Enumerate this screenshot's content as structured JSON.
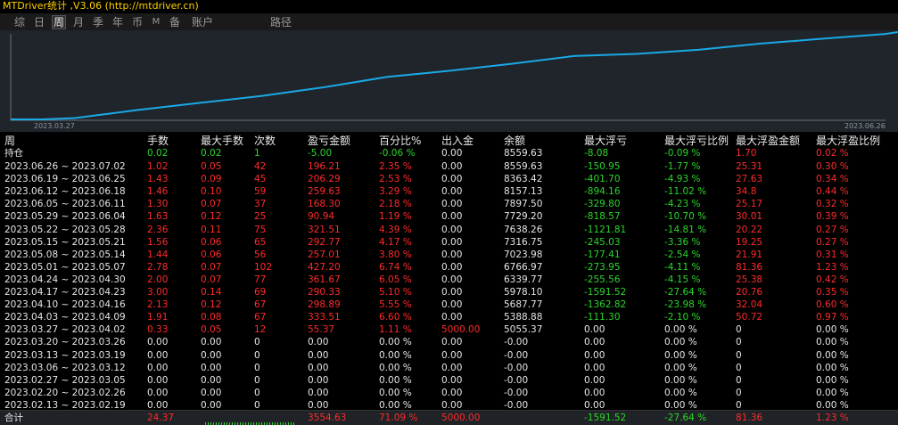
{
  "window": {
    "title": "MTDriver统计 ,V3.06 (http://mtdriver.cn)"
  },
  "tabs": [
    {
      "label": "综",
      "active": false
    },
    {
      "label": "日",
      "active": false
    },
    {
      "label": "周",
      "active": true
    },
    {
      "label": "月",
      "active": false
    },
    {
      "label": "季",
      "active": false
    },
    {
      "label": "年",
      "active": false
    },
    {
      "label": "币",
      "active": false
    },
    {
      "label": "M",
      "active": false
    },
    {
      "label": "备",
      "active": false
    },
    {
      "label": "账户",
      "active": false
    },
    {
      "label": "路径",
      "active": false
    }
  ],
  "colors": {
    "curve": "#1aa9e6",
    "red": "#ff2a2a",
    "green": "#2bd62b",
    "white": "#e6e6e6",
    "chart_bg": "#1f252b"
  },
  "chart_data": {
    "type": "line",
    "title": "",
    "x_start_label": "2023.03.27",
    "x_end_label": "2023.06.26",
    "x": [
      "2023.02.13",
      "2023.02.20",
      "2023.02.27",
      "2023.03.06",
      "2023.03.13",
      "2023.03.20",
      "2023.03.27",
      "2023.04.03",
      "2023.04.10",
      "2023.04.17",
      "2023.04.24",
      "2023.05.01",
      "2023.05.08",
      "2023.05.15",
      "2023.05.22",
      "2023.05.29",
      "2023.06.05",
      "2023.06.12",
      "2023.06.19",
      "2023.06.26"
    ],
    "series": [
      {
        "values": [
          0,
          0,
          0,
          0,
          0,
          0,
          5055.37,
          5388.88,
          5687.77,
          5978.1,
          6339.77,
          6766.97,
          7023.98,
          7316.75,
          7638.26,
          7729.2,
          7897.5,
          8157.13,
          8363.42,
          8559.63
        ]
      }
    ],
    "ylim": [
      5000,
      8600
    ]
  },
  "table": {
    "headers": [
      "周",
      "手数",
      "最大手数",
      "次数",
      "盈亏金额",
      "百分比%",
      "出入金",
      "余额",
      "最大浮亏",
      "最大浮亏比例",
      "最大浮盈金额",
      "最大浮盈比例"
    ],
    "holding": {
      "label": "持仓",
      "cells": [
        "0.02",
        "0.02",
        "1",
        "-5.00",
        "-0.06 %",
        "0.00",
        "8559.63",
        "-8.08",
        "-0.09 %",
        "1.70",
        "0.02 %"
      ]
    },
    "rows": [
      [
        "2023.06.26 ~ 2023.07.02",
        "1.02",
        "0.05",
        "42",
        "196.21",
        "2.35 %",
        "0.00",
        "8559.63",
        "-150.95",
        "-1.77 %",
        "25.31",
        "0.30 %"
      ],
      [
        "2023.06.19 ~ 2023.06.25",
        "1.43",
        "0.09",
        "45",
        "206.29",
        "2.53 %",
        "0.00",
        "8363.42",
        "-401.70",
        "-4.93 %",
        "27.63",
        "0.34 %"
      ],
      [
        "2023.06.12 ~ 2023.06.18",
        "1.46",
        "0.10",
        "59",
        "259.63",
        "3.29 %",
        "0.00",
        "8157.13",
        "-894.16",
        "-11.02 %",
        "34.8",
        "0.44 %"
      ],
      [
        "2023.06.05 ~ 2023.06.11",
        "1.30",
        "0.07",
        "37",
        "168.30",
        "2.18 %",
        "0.00",
        "7897.50",
        "-329.80",
        "-4.23 %",
        "25.17",
        "0.32 %"
      ],
      [
        "2023.05.29 ~ 2023.06.04",
        "1.63",
        "0.12",
        "25",
        "90.94",
        "1.19 %",
        "0.00",
        "7729.20",
        "-818.57",
        "-10.70 %",
        "30.01",
        "0.39 %"
      ],
      [
        "2023.05.22 ~ 2023.05.28",
        "2.36",
        "0.11",
        "75",
        "321.51",
        "4.39 %",
        "0.00",
        "7638.26",
        "-1121.81",
        "-14.81 %",
        "20.22",
        "0.27 %"
      ],
      [
        "2023.05.15 ~ 2023.05.21",
        "1.56",
        "0.06",
        "65",
        "292.77",
        "4.17 %",
        "0.00",
        "7316.75",
        "-245.03",
        "-3.36 %",
        "19.25",
        "0.27 %"
      ],
      [
        "2023.05.08 ~ 2023.05.14",
        "1.44",
        "0.06",
        "56",
        "257.01",
        "3.80 %",
        "0.00",
        "7023.98",
        "-177.41",
        "-2.54 %",
        "21.91",
        "0.31 %"
      ],
      [
        "2023.05.01 ~ 2023.05.07",
        "2.78",
        "0.07",
        "102",
        "427.20",
        "6.74 %",
        "0.00",
        "6766.97",
        "-273.95",
        "-4.11 %",
        "81.36",
        "1.23 %"
      ],
      [
        "2023.04.24 ~ 2023.04.30",
        "2.00",
        "0.07",
        "77",
        "361.67",
        "6.05 %",
        "0.00",
        "6339.77",
        "-255.56",
        "-4.15 %",
        "25.38",
        "0.42 %"
      ],
      [
        "2023.04.17 ~ 2023.04.23",
        "3.00",
        "0.14",
        "69",
        "290.33",
        "5.10 %",
        "0.00",
        "5978.10",
        "-1591.52",
        "-27.64 %",
        "20.76",
        "0.35 %"
      ],
      [
        "2023.04.10 ~ 2023.04.16",
        "2.13",
        "0.12",
        "67",
        "298.89",
        "5.55 %",
        "0.00",
        "5687.77",
        "-1362.82",
        "-23.98 %",
        "32.04",
        "0.60 %"
      ],
      [
        "2023.04.03 ~ 2023.04.09",
        "1.91",
        "0.08",
        "67",
        "333.51",
        "6.60 %",
        "0.00",
        "5388.88",
        "-111.30",
        "-2.10 %",
        "50.72",
        "0.97 %"
      ],
      [
        "2023.03.27 ~ 2023.04.02",
        "0.33",
        "0.05",
        "12",
        "55.37",
        "1.11 %",
        "5000.00",
        "5055.37",
        "0.00",
        "0.00 %",
        "0",
        "0.00 %"
      ],
      [
        "2023.03.20 ~ 2023.03.26",
        "0.00",
        "0.00",
        "0",
        "0.00",
        "0.00 %",
        "0.00",
        "-0.00",
        "0.00",
        "0.00 %",
        "0",
        "0.00 %"
      ],
      [
        "2023.03.13 ~ 2023.03.19",
        "0.00",
        "0.00",
        "0",
        "0.00",
        "0.00 %",
        "0.00",
        "-0.00",
        "0.00",
        "0.00 %",
        "0",
        "0.00 %"
      ],
      [
        "2023.03.06 ~ 2023.03.12",
        "0.00",
        "0.00",
        "0",
        "0.00",
        "0.00 %",
        "0.00",
        "-0.00",
        "0.00",
        "0.00 %",
        "0",
        "0.00 %"
      ],
      [
        "2023.02.27 ~ 2023.03.05",
        "0.00",
        "0.00",
        "0",
        "0.00",
        "0.00 %",
        "0.00",
        "-0.00",
        "0.00",
        "0.00 %",
        "0",
        "0.00 %"
      ],
      [
        "2023.02.20 ~ 2023.02.26",
        "0.00",
        "0.00",
        "0",
        "0.00",
        "0.00 %",
        "0.00",
        "-0.00",
        "0.00",
        "0.00 %",
        "0",
        "0.00 %"
      ],
      [
        "2023.02.13 ~ 2023.02.19",
        "0.00",
        "0.00",
        "0",
        "0.00",
        "0.00 %",
        "0.00",
        "-0.00",
        "0.00",
        "0.00 %",
        "0",
        "0.00 %"
      ]
    ],
    "total": {
      "label": "合计",
      "lots": "24.37",
      "pnl": "3554.63",
      "pct": "71.09 %",
      "deposit": "5000.00",
      "max_float_loss": "-1591.52",
      "max_float_loss_pct": "-27.64 %",
      "max_float_profit": "81.36",
      "max_float_profit_pct": "1.23 %"
    }
  }
}
